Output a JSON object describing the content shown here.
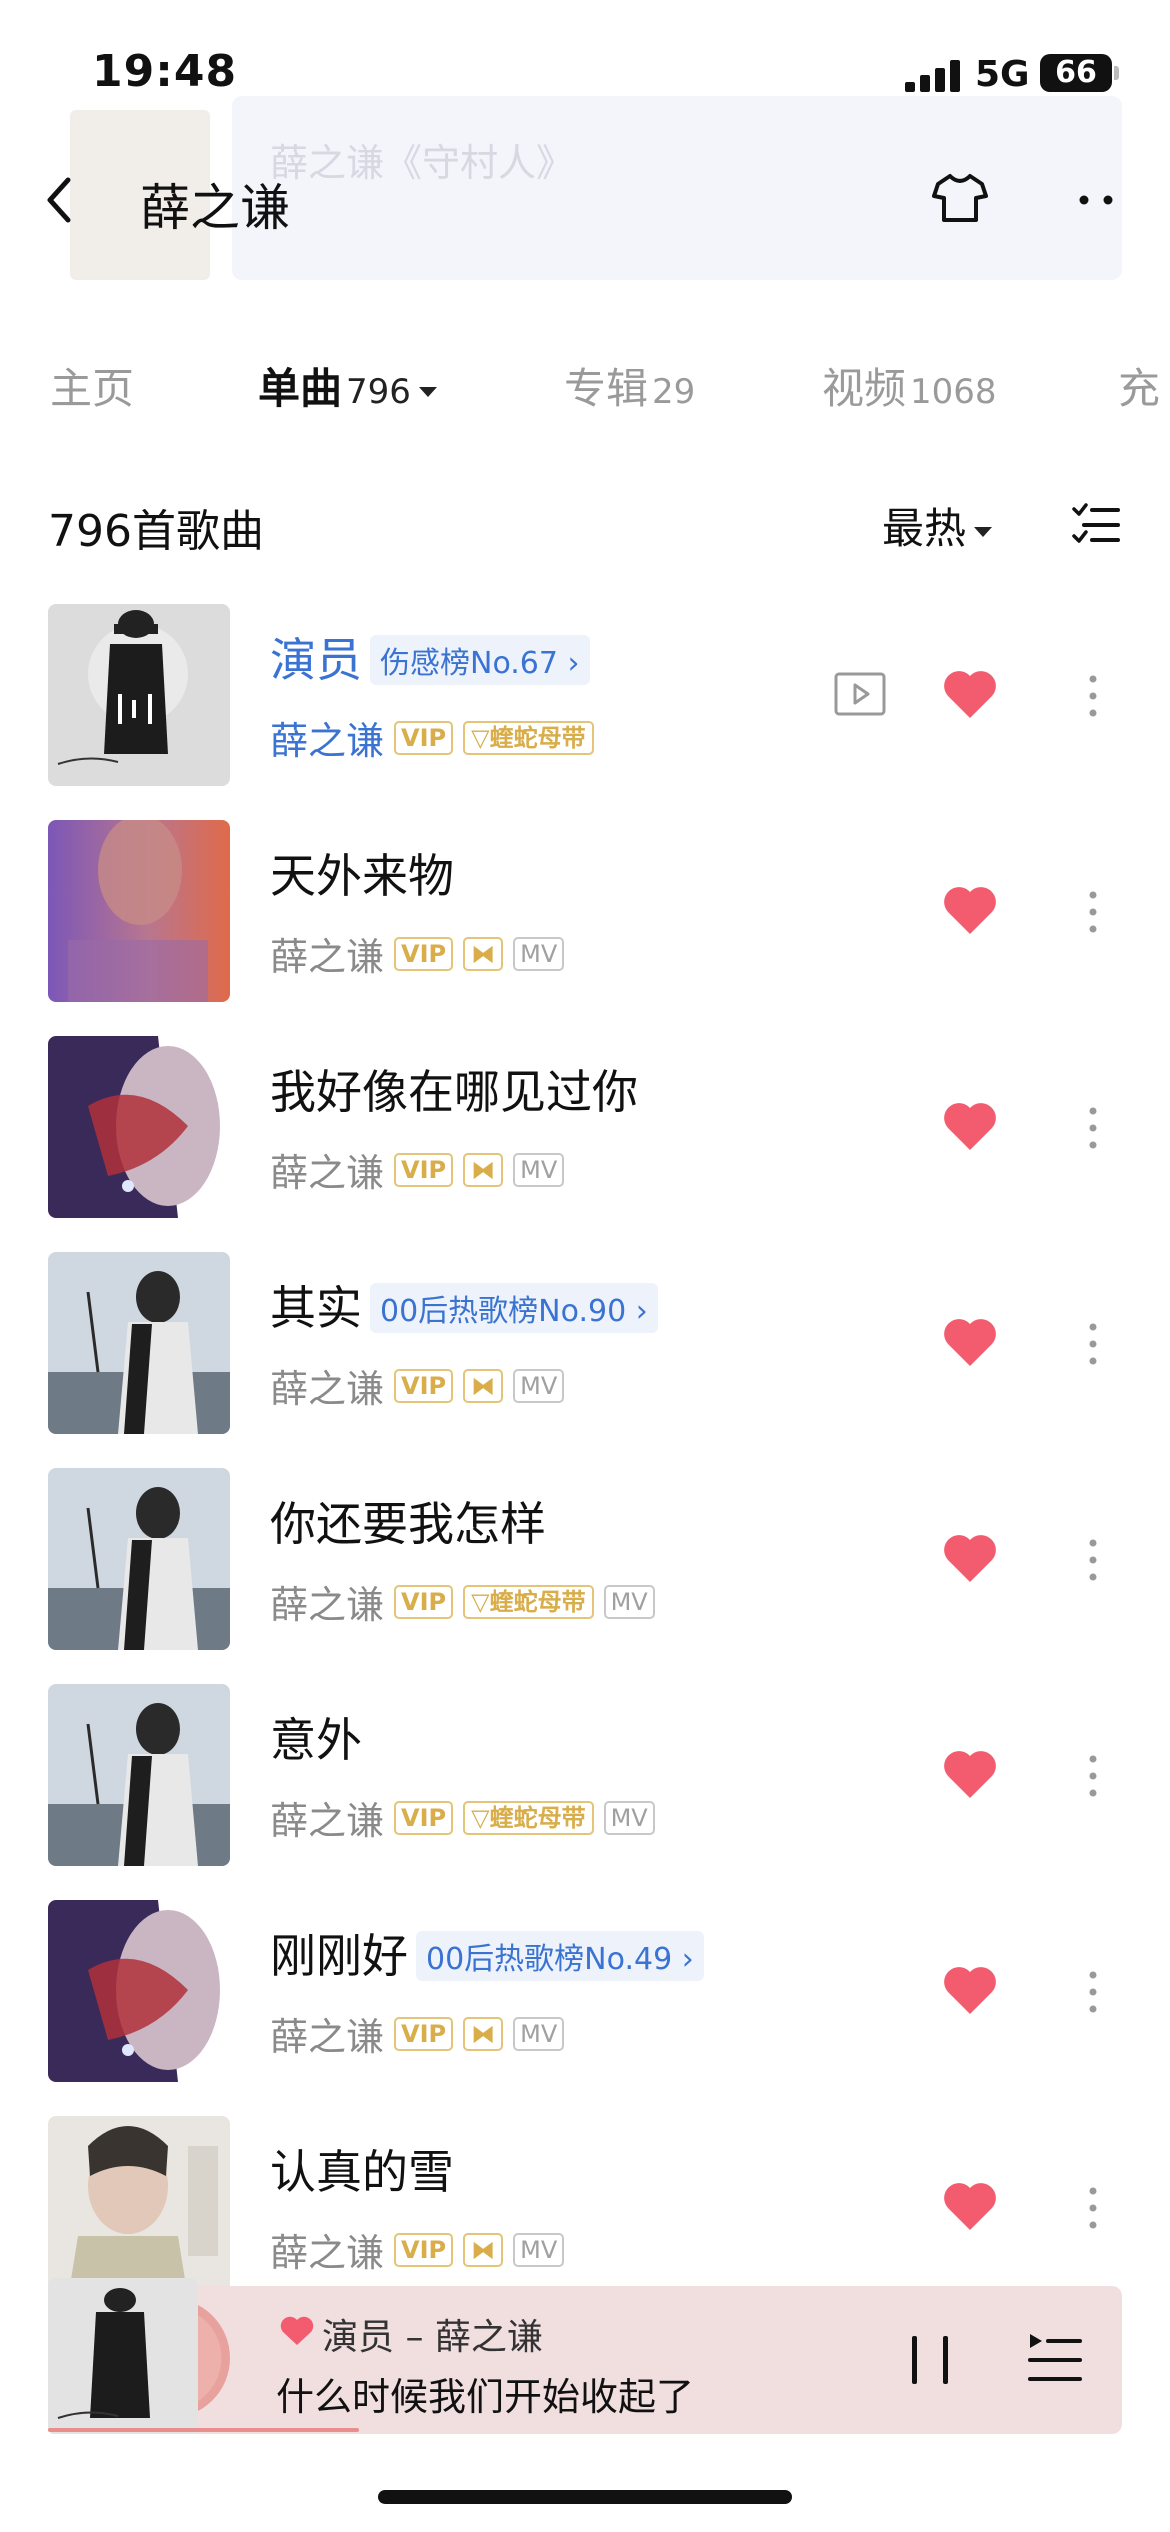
{
  "status_bar": {
    "time": "19:48",
    "network": "5G",
    "battery": "66"
  },
  "banner": {
    "faded_text": "薛之谦《守村人》"
  },
  "header": {
    "title": "薛之谦"
  },
  "tabs": [
    {
      "label": "主页",
      "count": ""
    },
    {
      "label": "单曲",
      "count": "796"
    },
    {
      "label": "专辑",
      "count": "29"
    },
    {
      "label": "视频",
      "count": "1068"
    },
    {
      "label": "充",
      "count": ""
    }
  ],
  "list_header": {
    "song_count": "796首歌曲",
    "sort": "最热"
  },
  "songs": [
    {
      "title": "演员",
      "tag": "伤感榜No.67",
      "artist": "薛之谦",
      "vip": "VIP",
      "extra": "蝰蛇母带",
      "mv": ""
    },
    {
      "title": "天外来物",
      "tag": "",
      "artist": "薛之谦",
      "vip": "VIP",
      "extra": "",
      "mv": "MV"
    },
    {
      "title": "我好像在哪见过你",
      "tag": "",
      "artist": "薛之谦",
      "vip": "VIP",
      "extra": "",
      "mv": "MV"
    },
    {
      "title": "其实",
      "tag": "00后热歌榜No.90",
      "artist": "薛之谦",
      "vip": "VIP",
      "extra": "",
      "mv": "MV"
    },
    {
      "title": "你还要我怎样",
      "tag": "",
      "artist": "薛之谦",
      "vip": "VIP",
      "extra": "蝰蛇母带",
      "mv": "MV"
    },
    {
      "title": "意外",
      "tag": "",
      "artist": "薛之谦",
      "vip": "VIP",
      "extra": "蝰蛇母带",
      "mv": "MV"
    },
    {
      "title": "刚刚好",
      "tag": "00后热歌榜No.49",
      "artist": "薛之谦",
      "vip": "VIP",
      "extra": "",
      "mv": "MV"
    },
    {
      "title": "认真的雪",
      "tag": "",
      "artist": "薛之谦",
      "vip": "VIP",
      "extra": "",
      "mv": "MV"
    }
  ],
  "player": {
    "song": "演员 – 薛之谦",
    "lyric": "什么时候我们开始收起了",
    "progress": 0.29
  },
  "colors": {
    "accent": "#3a73d1",
    "heart": "#f25c6e",
    "vip_gold": "#d8ad4a"
  }
}
